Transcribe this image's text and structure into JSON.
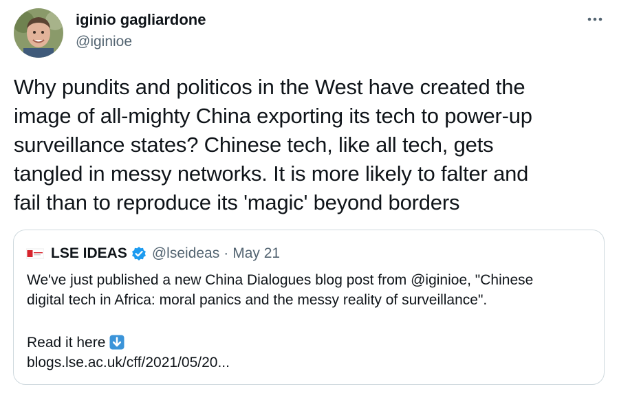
{
  "author": {
    "display_name": "iginio gagliardone",
    "handle": "@iginioe"
  },
  "more_icon": "ellipsis-icon",
  "tweet": {
    "text": "Why pundits and politicos in the West have created the\nimage of all-mighty China exporting its tech to power-up\nsurveillance states? Chinese tech, like all tech, gets\ntangled in messy networks. It is more likely to falter and\nfail than to reproduce its 'magic' beyond borders"
  },
  "quote": {
    "display_name": "LSE IDEAS",
    "verified_icon": "verified-badge-icon",
    "handle": "@lseideas",
    "separator": "·",
    "date": "May 21",
    "lines": [
      "We've just published a new China Dialogues blog post from @iginioe, \"Chinese",
      "digital tech in Africa: moral panics and the messy reality of surveillance\"."
    ],
    "read_label": "Read it here",
    "read_icon": "down-arrow-icon",
    "link": "blogs.lse.ac.uk/cff/2021/05/20..."
  },
  "colors": {
    "text": "#0f1419",
    "secondary": "#536471",
    "border": "#cfd9de",
    "verified": "#1d9bf0",
    "arrow_emoji": "#3b94d9",
    "lse_red": "#d6242d"
  }
}
